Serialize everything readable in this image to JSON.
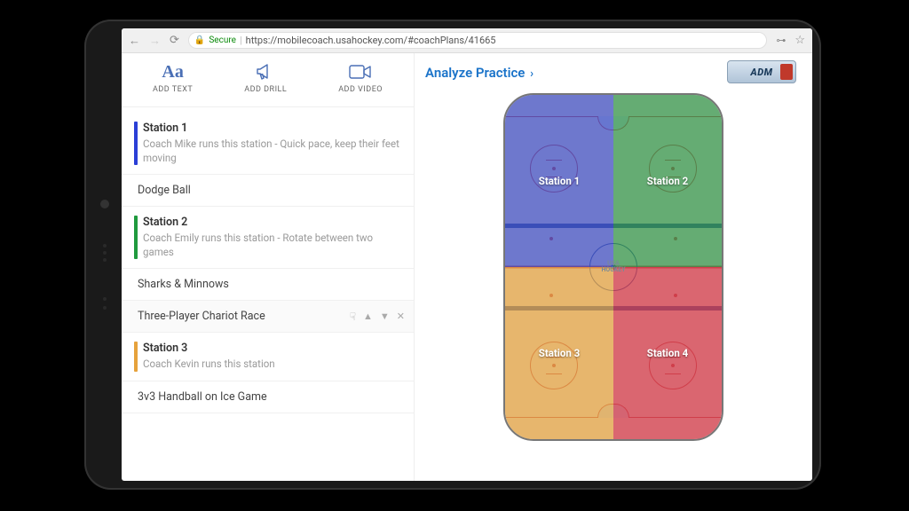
{
  "browser": {
    "secure_label": "Secure",
    "url": "https://mobilecoach.usahockey.com/#coachPlans/41665"
  },
  "toolbar": {
    "add_text": "ADD TEXT",
    "add_drill": "ADD DRILL",
    "add_video": "ADD VIDEO"
  },
  "list": [
    {
      "type": "station",
      "color": "#2b3fd6",
      "title": "Station 1",
      "desc": "Coach Mike runs this station - Quick pace, keep their feet moving"
    },
    {
      "type": "drill",
      "title": "Dodge Ball"
    },
    {
      "type": "station",
      "color": "#1f9a3e",
      "title": "Station 2",
      "desc": "Coach Emily runs this station - Rotate between two games"
    },
    {
      "type": "drill",
      "title": "Sharks & Minnows"
    },
    {
      "type": "drill",
      "title": "Three-Player Chariot Race",
      "selected": true
    },
    {
      "type": "station",
      "color": "#e6a23c",
      "title": "Station 3",
      "desc": "Coach Kevin runs this station"
    },
    {
      "type": "drill",
      "title": "3v3 Handball on Ice Game"
    }
  ],
  "right": {
    "analyze_label": "Analyze Practice",
    "adm_label": "ADM"
  },
  "rink": {
    "center_logo": "USA\nHOCKEY",
    "stations": [
      "Station 1",
      "Station 2",
      "Station 3",
      "Station 4"
    ]
  }
}
